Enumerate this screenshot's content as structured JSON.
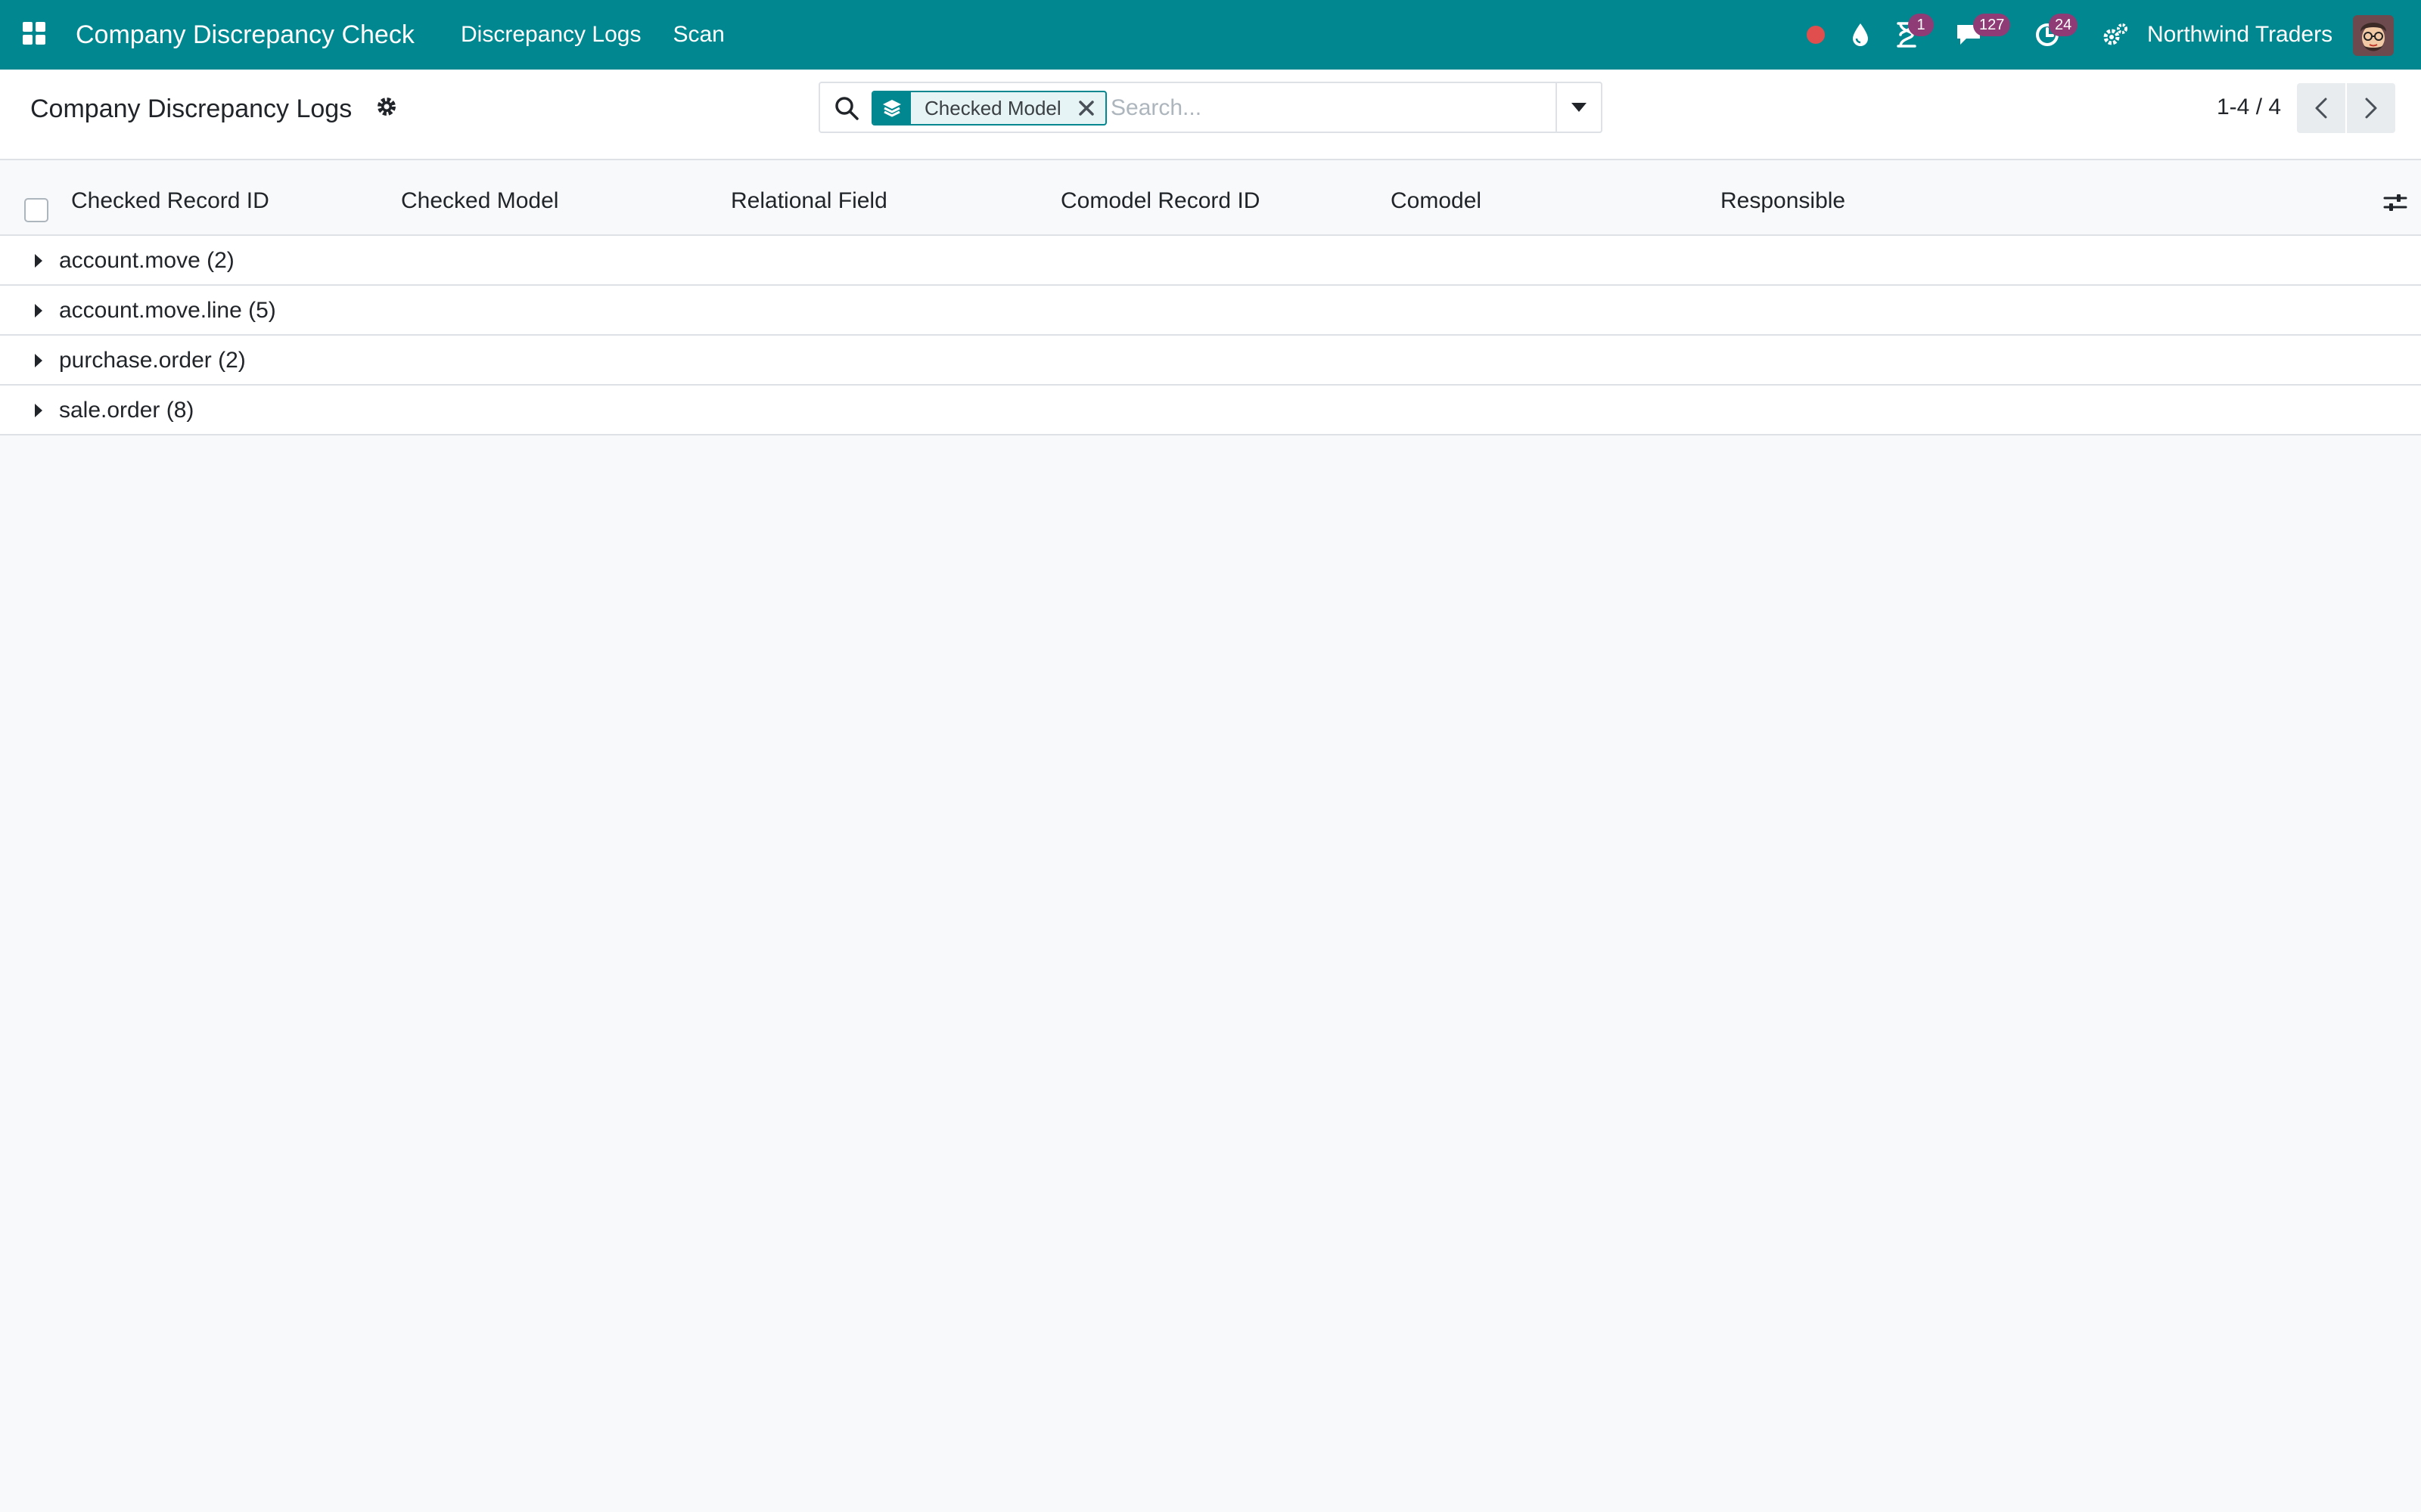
{
  "navbar": {
    "app_title": "Company Discrepancy Check",
    "menu": [
      {
        "label": "Discrepancy Logs"
      },
      {
        "label": "Scan"
      }
    ],
    "systray": {
      "activity_badge": "1",
      "messages_badge": "127",
      "clock_badge": "24",
      "company": "Northwind Traders"
    },
    "colors": {
      "brand": "#01878f",
      "badge": "#8f3b76",
      "recording": "#e04e4e"
    }
  },
  "control_panel": {
    "title": "Company Discrepancy Logs",
    "search": {
      "facet_label": "Checked Model",
      "placeholder": "Search..."
    },
    "pager": {
      "value": "1-4 / 4"
    }
  },
  "list": {
    "columns": [
      {
        "label": "Checked Record ID"
      },
      {
        "label": "Checked Model"
      },
      {
        "label": "Relational Field"
      },
      {
        "label": "Comodel Record ID"
      },
      {
        "label": "Comodel"
      },
      {
        "label": "Responsible"
      }
    ],
    "groups": [
      {
        "label": "account.move (2)"
      },
      {
        "label": "account.move.line (5)"
      },
      {
        "label": "purchase.order (2)"
      },
      {
        "label": "sale.order (8)"
      }
    ]
  }
}
